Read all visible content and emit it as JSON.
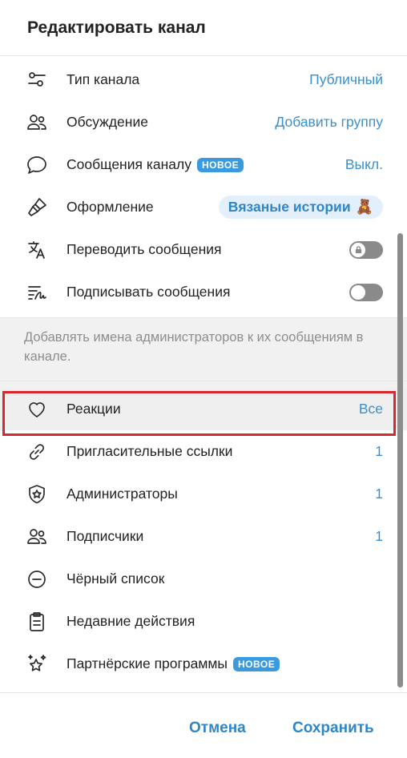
{
  "dialog": {
    "title": "Редактировать канал"
  },
  "settings": {
    "channel_type": {
      "label": "Тип канала",
      "value": "Публичный",
      "icon": "sliders-icon"
    },
    "discussion": {
      "label": "Обсуждение",
      "value": "Добавить группу",
      "icon": "people-icon"
    },
    "channel_messages": {
      "label": "Сообщения каналу",
      "badge": "НОВОЕ",
      "value": "Выкл.",
      "icon": "chat-bubble-icon"
    },
    "appearance": {
      "label": "Оформление",
      "value": "Вязаные истории",
      "value_emoji": "🧸",
      "icon": "brush-icon"
    },
    "translate": {
      "label": "Переводить сообщения",
      "state": "off-locked",
      "icon": "translate-icon"
    },
    "sign": {
      "label": "Подписывать сообщения",
      "state": "off",
      "icon": "signature-icon"
    }
  },
  "sign_note": "Добавлять имена администраторов к их сообщениям в канале.",
  "management": {
    "reactions": {
      "label": "Реакции",
      "value": "Все",
      "icon": "heart-icon"
    },
    "invite_links": {
      "label": "Пригласительные ссылки",
      "value": "1",
      "icon": "link-icon"
    },
    "admins": {
      "label": "Администраторы",
      "value": "1",
      "icon": "shield-star-icon"
    },
    "subscribers": {
      "label": "Подписчики",
      "value": "1",
      "icon": "people-icon"
    },
    "blacklist": {
      "label": "Чёрный список",
      "icon": "minus-circle-icon"
    },
    "recent_actions": {
      "label": "Недавние действия",
      "icon": "clipboard-icon"
    },
    "affiliate": {
      "label": "Партнёрские программы",
      "badge": "НОВОЕ",
      "icon": "stars-icon"
    }
  },
  "footer": {
    "cancel": "Отмена",
    "save": "Сохранить"
  },
  "colors": {
    "accent": "#3a8fce",
    "badge": "#3a9ae0",
    "highlight_border": "#d9272e"
  }
}
